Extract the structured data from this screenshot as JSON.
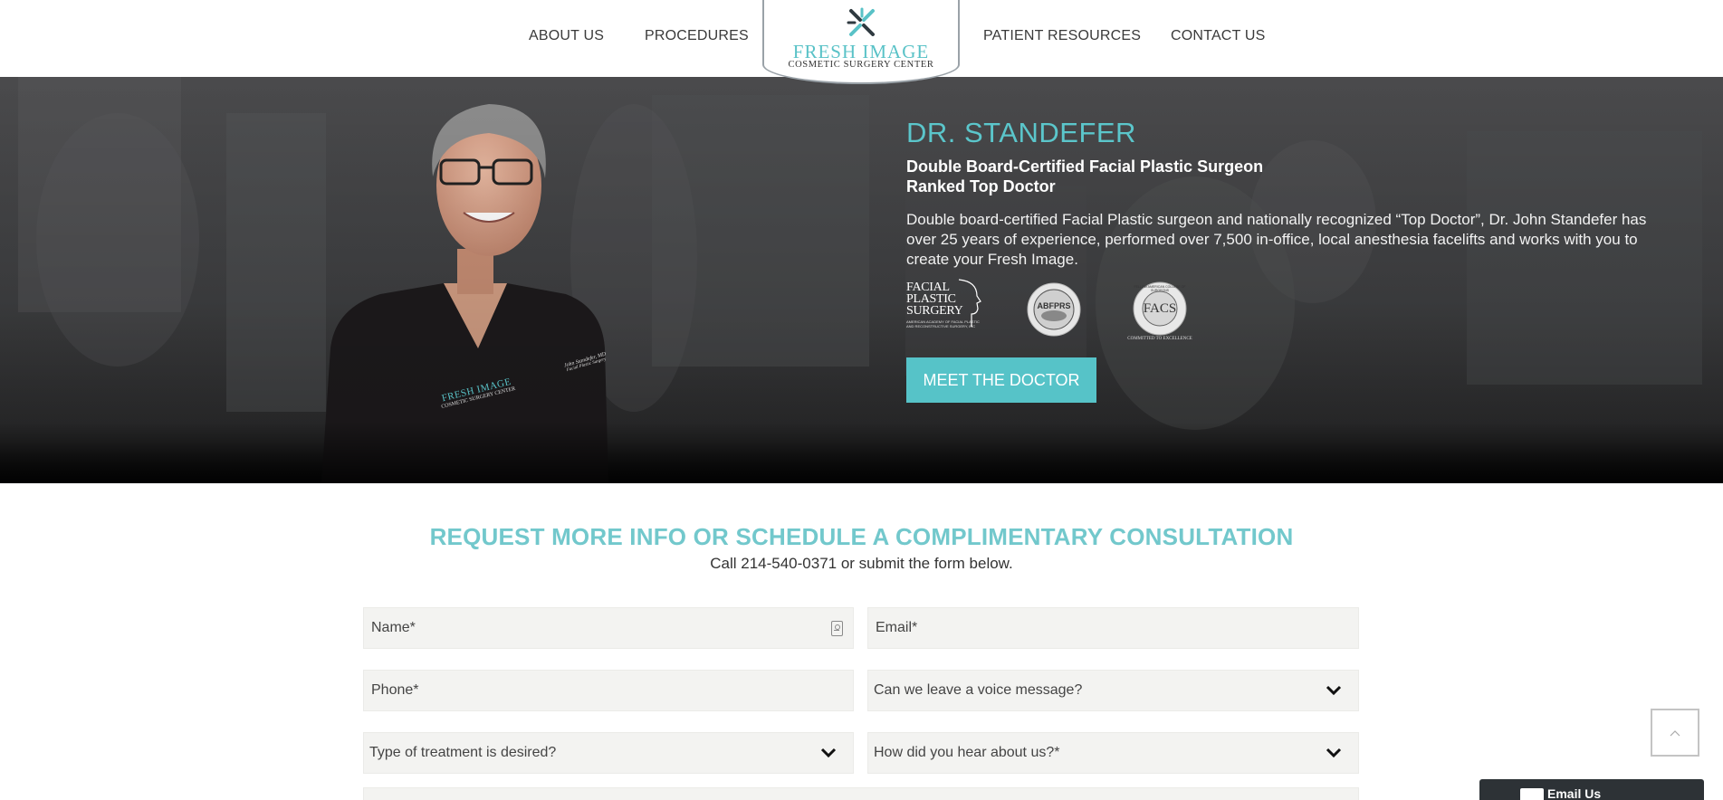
{
  "nav": {
    "items": [
      "ABOUT US",
      "PROCEDURES",
      "PATIENT RESOURCES",
      "CONTACT US"
    ],
    "logo": {
      "name": "FRESH IMAGE",
      "tagline": "COSMETIC SURGERY CENTER"
    }
  },
  "hero": {
    "title": "DR. STANDEFER",
    "subtitle_1": "Double Board-Certified Facial Plastic Surgeon",
    "subtitle_2": "Ranked Top Doctor",
    "description": "Double board-certified Facial Plastic surgeon and nationally recognized “Top Doctor”, Dr. John Standefer has over 25 years of experience, performed over 7,500 in-office, local anesthesia facelifts and works with you to create your Fresh Image.",
    "badges": {
      "aafprs": {
        "line1": "FACIAL",
        "line2": "PLASTIC",
        "line3": "SURGERY",
        "small": "AMERICAN ACADEMY OF FACIAL PLASTIC AND RECONSTRUCTIVE SURGERY, INC"
      },
      "abfprs": {
        "text": "ABFPRS"
      },
      "facs": {
        "text": "FACS",
        "ring": "FELLOW AMERICAN COLLEGE OF SURGEONS",
        "small": "COMMITTED TO EXCELLENCE"
      }
    },
    "scrub_logo": {
      "name": "FRESH IMAGE",
      "tagline": "COSMETIC SURGERY CENTER",
      "embroidery": "John Standefer, MD",
      "embroidery_2": "Facial Plastic Surgery"
    },
    "cta_label": "MEET THE DOCTOR"
  },
  "consult": {
    "title": "REQUEST MORE INFO OR SCHEDULE A COMPLIMENTARY CONSULTATION",
    "subtitle": "Call 214-540-0371 or submit the form below."
  },
  "form": {
    "name_placeholder": "Name*",
    "email_placeholder": "Email*",
    "phone_placeholder": "Phone*",
    "voice_select": "Can we leave a voice message?",
    "treatment_select": "Type of treatment is desired?",
    "hear_select": "How did you hear about us?*"
  },
  "widgets": {
    "email_us_label": "Email Us"
  },
  "colors": {
    "accent": "#56c3c8",
    "hero_bg": "#3f4042",
    "field_bg": "#f3f3f1"
  }
}
